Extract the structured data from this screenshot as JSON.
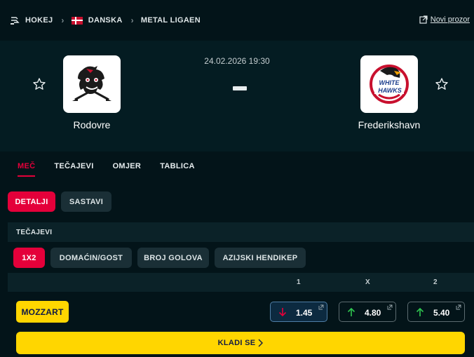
{
  "breadcrumb": {
    "sport": "HOKEJ",
    "country": "DANSKA",
    "league": "METAL LIGAEN",
    "new_window": "Novi prozor"
  },
  "match": {
    "datetime": "24.02.2026 19:30",
    "home": {
      "name": "Rodovre",
      "logo_icon": "rodovre-mighty-bulls-logo"
    },
    "away": {
      "name": "Frederikshavn",
      "logo_icon": "white-hawks-logo",
      "logo_text": [
        "WHITE",
        "HAWKS"
      ]
    }
  },
  "tabs": [
    "MEČ",
    "TEČAJEVI",
    "OMJER",
    "TABLICA"
  ],
  "subtabs": {
    "details": "DETALJI",
    "lineups": "SASTAVI"
  },
  "odds_section": {
    "title": "TEČAJEVI",
    "markets": [
      "1X2",
      "DOMAĆIN/GOST",
      "BROJ GOLOVA",
      "AZIJSKI HENDIKEP"
    ],
    "columns": [
      "1",
      "X",
      "2"
    ],
    "bookmaker": "MOZZART",
    "values": [
      {
        "label": "1.45",
        "trend": "down"
      },
      {
        "label": "4.80",
        "trend": "up"
      },
      {
        "label": "5.40",
        "trend": "up"
      }
    ],
    "bet_label": "KLADI SE"
  },
  "colors": {
    "accent": "#e4003a",
    "bookmaker_yellow": "#ffd600",
    "background": "#031419",
    "trend_up": "#2fc54f",
    "trend_down": "#e4003a"
  }
}
